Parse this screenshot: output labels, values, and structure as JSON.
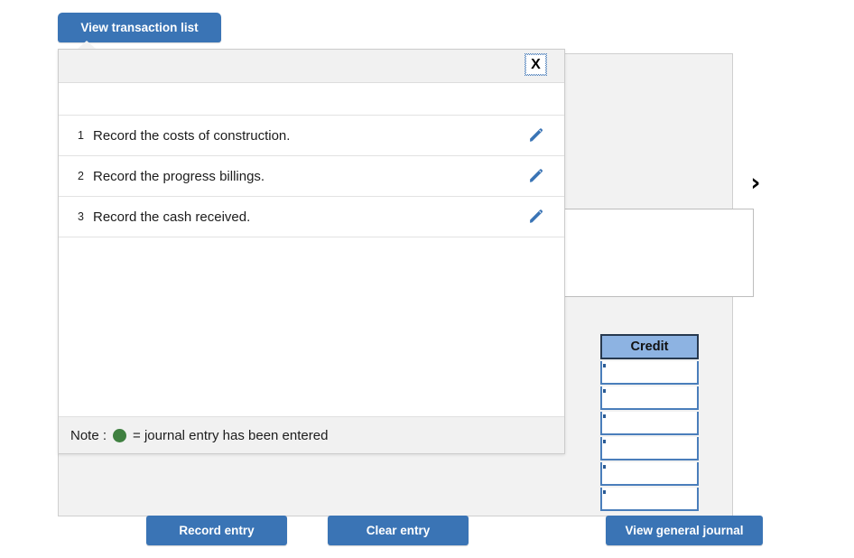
{
  "tab_button": {
    "label": "View transaction list"
  },
  "popover": {
    "close_label": "X",
    "transactions": [
      {
        "index": "1",
        "label": "Record the costs of construction.",
        "edit_icon": "pencil-icon"
      },
      {
        "index": "2",
        "label": "Record the progress billings.",
        "edit_icon": "pencil-icon"
      },
      {
        "index": "3",
        "label": "Record the cash received.",
        "edit_icon": "pencil-icon"
      }
    ],
    "note": {
      "prefix": "Note :",
      "dot_color": "#3f8040",
      "text": "= journal entry has been entered"
    }
  },
  "worksheet": {
    "next_icon": "chevron-right-icon",
    "credit_column": {
      "header": "Credit",
      "cells": [
        "",
        "",
        "",
        "",
        "",
        ""
      ]
    },
    "buttons": {
      "record_entry": "Record entry",
      "clear_entry": "Clear entry",
      "view_general_journal": "View general journal"
    }
  },
  "colors": {
    "accent_blue": "#3a74b5",
    "header_blue": "#8db3e2",
    "cell_border_blue": "#4a7ebb",
    "panel_grey": "#f2f2f2",
    "note_green": "#3f8040"
  }
}
